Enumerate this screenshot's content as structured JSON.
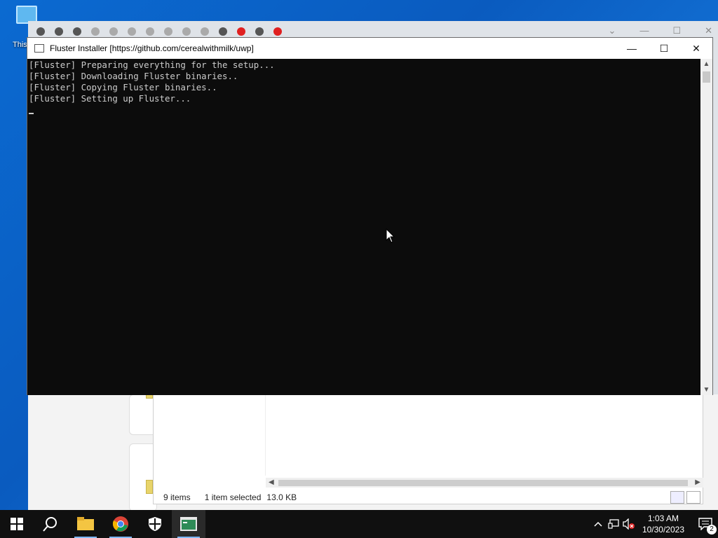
{
  "desktop": {
    "icon_label": "This"
  },
  "console": {
    "title": "Fluster Installer [https://github.com/cerealwithmilk/uwp]",
    "lines": [
      "[Fluster] Preparing everything for the setup...",
      "[Fluster] Downloading Fluster binaries..",
      "[Fluster] Copying Fluster binaries..",
      "[Fluster] Setting up Fluster..."
    ],
    "minimize_icon": "minimize-icon",
    "maximize_icon": "maximize-icon",
    "close_icon": "close-icon"
  },
  "explorer": {
    "item_count": "9 items",
    "selected": "1 item selected",
    "selected_size": "13.0 KB"
  },
  "taskbar": {
    "apps": [
      "start-icon",
      "search-icon",
      "file-explorer-icon",
      "chrome-icon",
      "security-icon",
      "console-icon"
    ],
    "time": "1:03 AM",
    "date": "10/30/2023",
    "notification_count": "2"
  }
}
